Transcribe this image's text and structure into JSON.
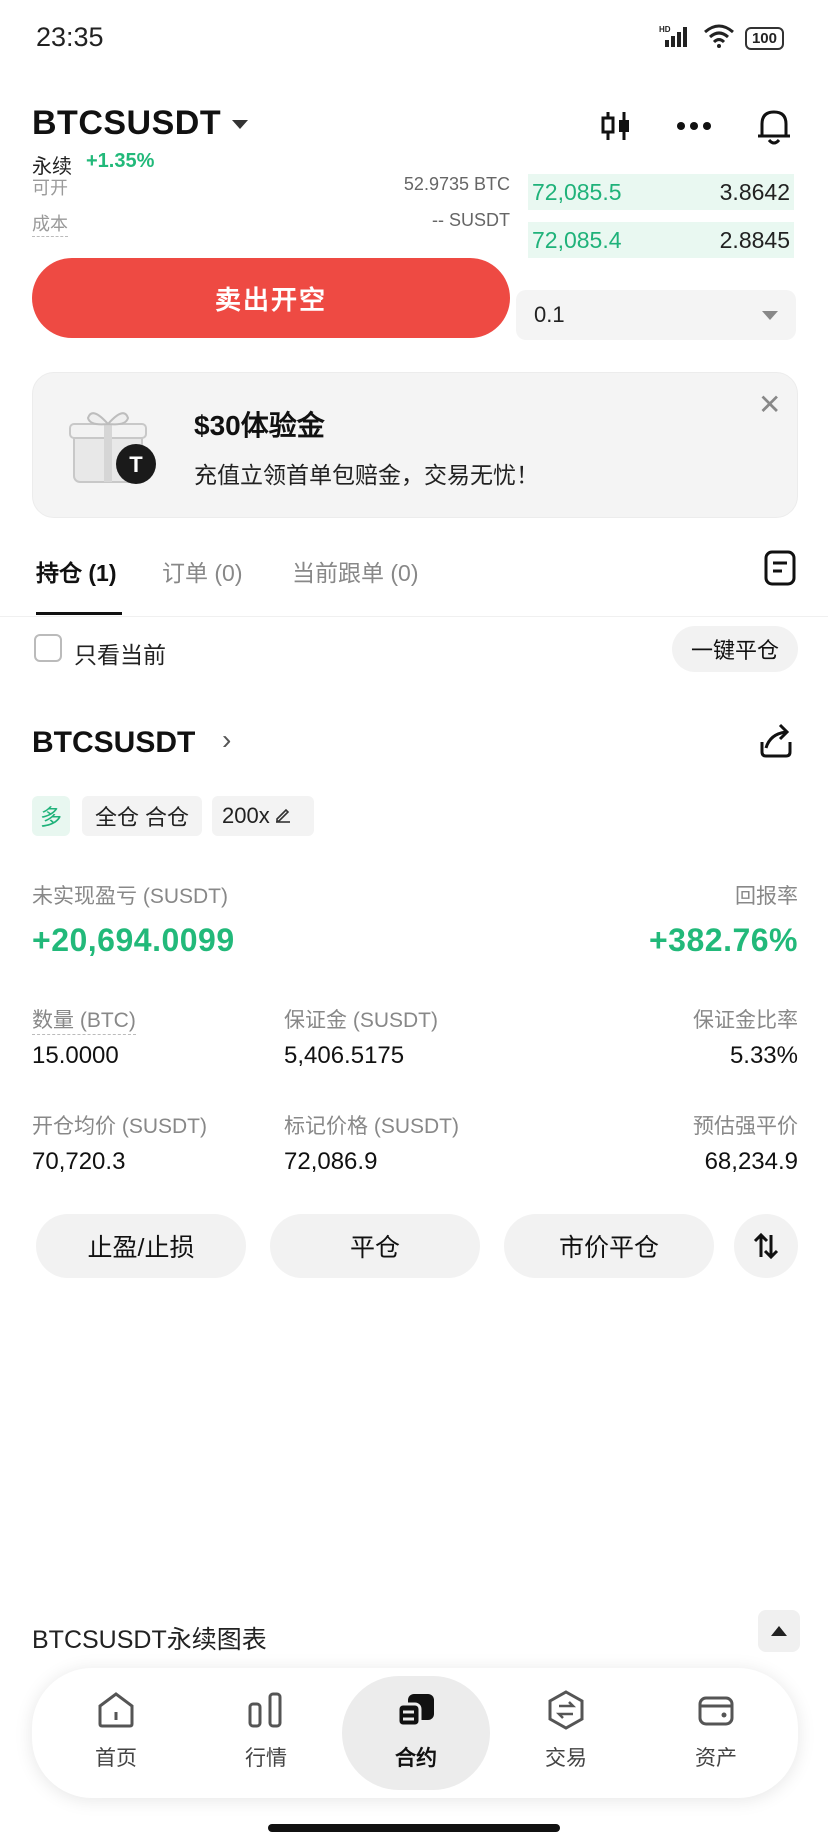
{
  "status_bar": {
    "time": "23:35",
    "battery": "100",
    "network": "HD"
  },
  "header": {
    "pair": "BTCSUSDT",
    "type": "永续",
    "change": "+1.35%"
  },
  "trade_panel": {
    "available_label": "可开",
    "available_value": "52.9735 BTC",
    "cost_label": "成本",
    "cost_value": "-- SUSDT",
    "orderbook": [
      {
        "price": "72,085.5",
        "qty": "3.8642"
      },
      {
        "price": "72,085.4",
        "qty": "2.8845"
      }
    ],
    "sell_button": "卖出开空",
    "quantity": "0.1"
  },
  "promo": {
    "title": "$30体验金",
    "subtitle": "充值立领首单包赔金，交易无忧！"
  },
  "tabs": [
    {
      "label": "持仓 (1)"
    },
    {
      "label": "订单 (0)"
    },
    {
      "label": "当前跟单 (0)"
    }
  ],
  "filter": {
    "only_current": "只看当前",
    "close_all": "一键平仓"
  },
  "position": {
    "symbol": "BTCSUSDT",
    "tags": {
      "side": "多",
      "mode": "全仓 合仓",
      "leverage": "200x"
    },
    "pnl_label": "未实现盈亏 (SUSDT)",
    "pnl_value": "+20,694.0099",
    "roe_label": "回报率",
    "roe_value": "+382.76%",
    "qty_label": "数量 (BTC)",
    "qty_value": "15.0000",
    "margin_label": "保证金 (SUSDT)",
    "margin_value": "5,406.5175",
    "margin_ratio_label": "保证金比率",
    "margin_ratio_value": "5.33%",
    "entry_label": "开仓均价 (SUSDT)",
    "entry_value": "70,720.3",
    "mark_label": "标记价格 (SUSDT)",
    "mark_value": "72,086.9",
    "liq_label": "预估强平价",
    "liq_value": "68,234.9",
    "actions": {
      "tpsl": "止盈/止损",
      "close": "平仓",
      "market_close": "市价平仓"
    }
  },
  "chart_section": {
    "title": "BTCSUSDT永续图表"
  },
  "bottom_nav": [
    {
      "label": "首页",
      "icon": "home-icon"
    },
    {
      "label": "行情",
      "icon": "market-icon"
    },
    {
      "label": "合约",
      "icon": "futures-icon",
      "active": true
    },
    {
      "label": "交易",
      "icon": "trade-icon"
    },
    {
      "label": "资产",
      "icon": "wallet-icon"
    }
  ],
  "colors": {
    "up": "#22b97a",
    "sell": "#ee4a43"
  }
}
